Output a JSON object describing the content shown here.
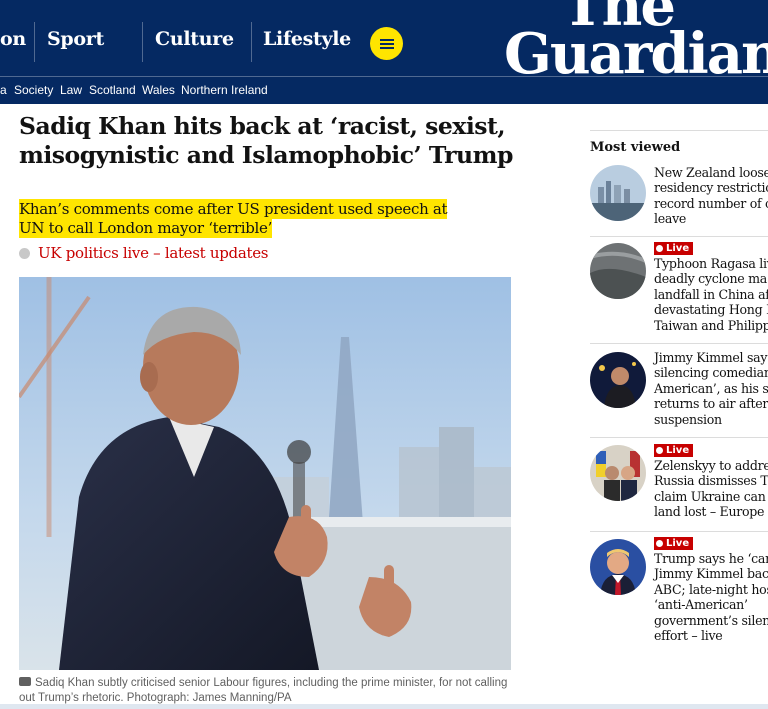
{
  "header": {
    "pillars": [
      "on",
      "Sport",
      "Culture",
      "Lifestyle"
    ],
    "logo_line1": "The",
    "logo_line2": "Guardian",
    "menu_icon": "hamburger-icon",
    "brand_color": "#052962",
    "accent_color": "#ffe500"
  },
  "subnav": {
    "items": [
      "a",
      "Society",
      "Law",
      "Scotland",
      "Wales",
      "Northern Ireland"
    ]
  },
  "article": {
    "headline": "Sadiq Khan hits back at ‘racist, sexist, misogynistic and Islamophobic’ Trump",
    "standfirst": "Khan’s comments come after US president used speech at UN to call London mayor ‘terrible’",
    "live_link": "UK politics live – latest updates",
    "caption": "Sadiq Khan subtly criticised senior Labour figures, including the prime minister, for not calling out Trump’s rhetoric. Photograph: James Manning/PA",
    "caption_icon": "camera-icon",
    "live_color": "#c70000"
  },
  "most_viewed": {
    "title": "Most viewed",
    "live_label": "Live",
    "items": [
      {
        "live": false,
        "lines": [
          "New Zealand looses",
          "residency restrictio",
          "record number of c",
          "leave"
        ]
      },
      {
        "live": true,
        "lines": [
          "Typhoon Ragasa liv",
          "deadly cyclone ma",
          "landfall in China af",
          "devastating Hong I",
          "Taiwan and Philipp"
        ]
      },
      {
        "live": false,
        "lines": [
          "Jimmy Kimmel say",
          "silencing comedian",
          "American’, as his sh",
          "returns to air after",
          "suspension"
        ]
      },
      {
        "live": true,
        "lines": [
          "Zelenskyy to addre",
          "Russia dismisses T",
          "claim Ukraine can r",
          "land lost – Europe l"
        ]
      },
      {
        "live": true,
        "lines": [
          "Trump says he ‘can",
          "Jimmy Kimmel bac",
          "ABC; late-night hos",
          "‘anti-American’",
          "government’s silen",
          "effort – live"
        ]
      }
    ]
  }
}
